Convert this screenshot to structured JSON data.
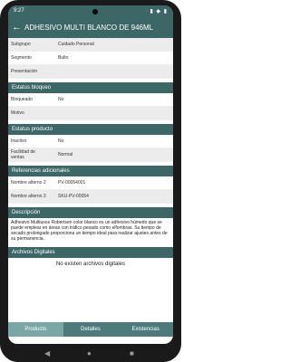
{
  "status": {
    "time": "9:27",
    "icons": "▮ ◆ ▮"
  },
  "appbar": {
    "back_icon": "←",
    "title": "ADHESIVO MULTI BLANCO DE 946ML"
  },
  "rows_top": [
    {
      "label": "Subgrupo",
      "value": "Cuidado Personal"
    },
    {
      "label": "Segmento",
      "value": "Bulto"
    },
    {
      "label": "Presentación",
      "value": ""
    }
  ],
  "sections": {
    "estatus_bloqueo": "Estatus bloqueo",
    "estatus_producto": "Estatus producto",
    "referencias": "Referencias adicionales",
    "descripcion": "Descripción",
    "archivos": "Archivos Digitales"
  },
  "rows_bloqueo": [
    {
      "label": "Bloqueado",
      "value": "No"
    },
    {
      "label": "Motivo",
      "value": ""
    }
  ],
  "rows_producto": [
    {
      "label": "Inactivo",
      "value": "No"
    },
    {
      "label": "Facilidad de ventas",
      "value": "Normal"
    }
  ],
  "rows_referencias": [
    {
      "label": "Nombre alterno 2",
      "value": "PV-00054001"
    },
    {
      "label": "Nombre alterno 3",
      "value": "SKU-PV-00054"
    }
  ],
  "descripcion_text": "Adhesivo Multiusos Robertsen color blanco es un adhesivo húmedo que se puede emplear en áreas con tráfico pesado como elfombras. Su tiempo de secado prolongado proporciona un tiempo ideal para realizar ajustes antes de su permanencia.",
  "archivos_text": "No existen archivos digitales",
  "tabs": [
    "Producto",
    "Detalles",
    "Existencias"
  ],
  "nav": {
    "back": "◀",
    "home": "●",
    "recent": "■"
  },
  "colors": {
    "primary": "#3d6666",
    "tab_active": "#7aa6a6",
    "tab_bg": "#4d7a7a"
  }
}
